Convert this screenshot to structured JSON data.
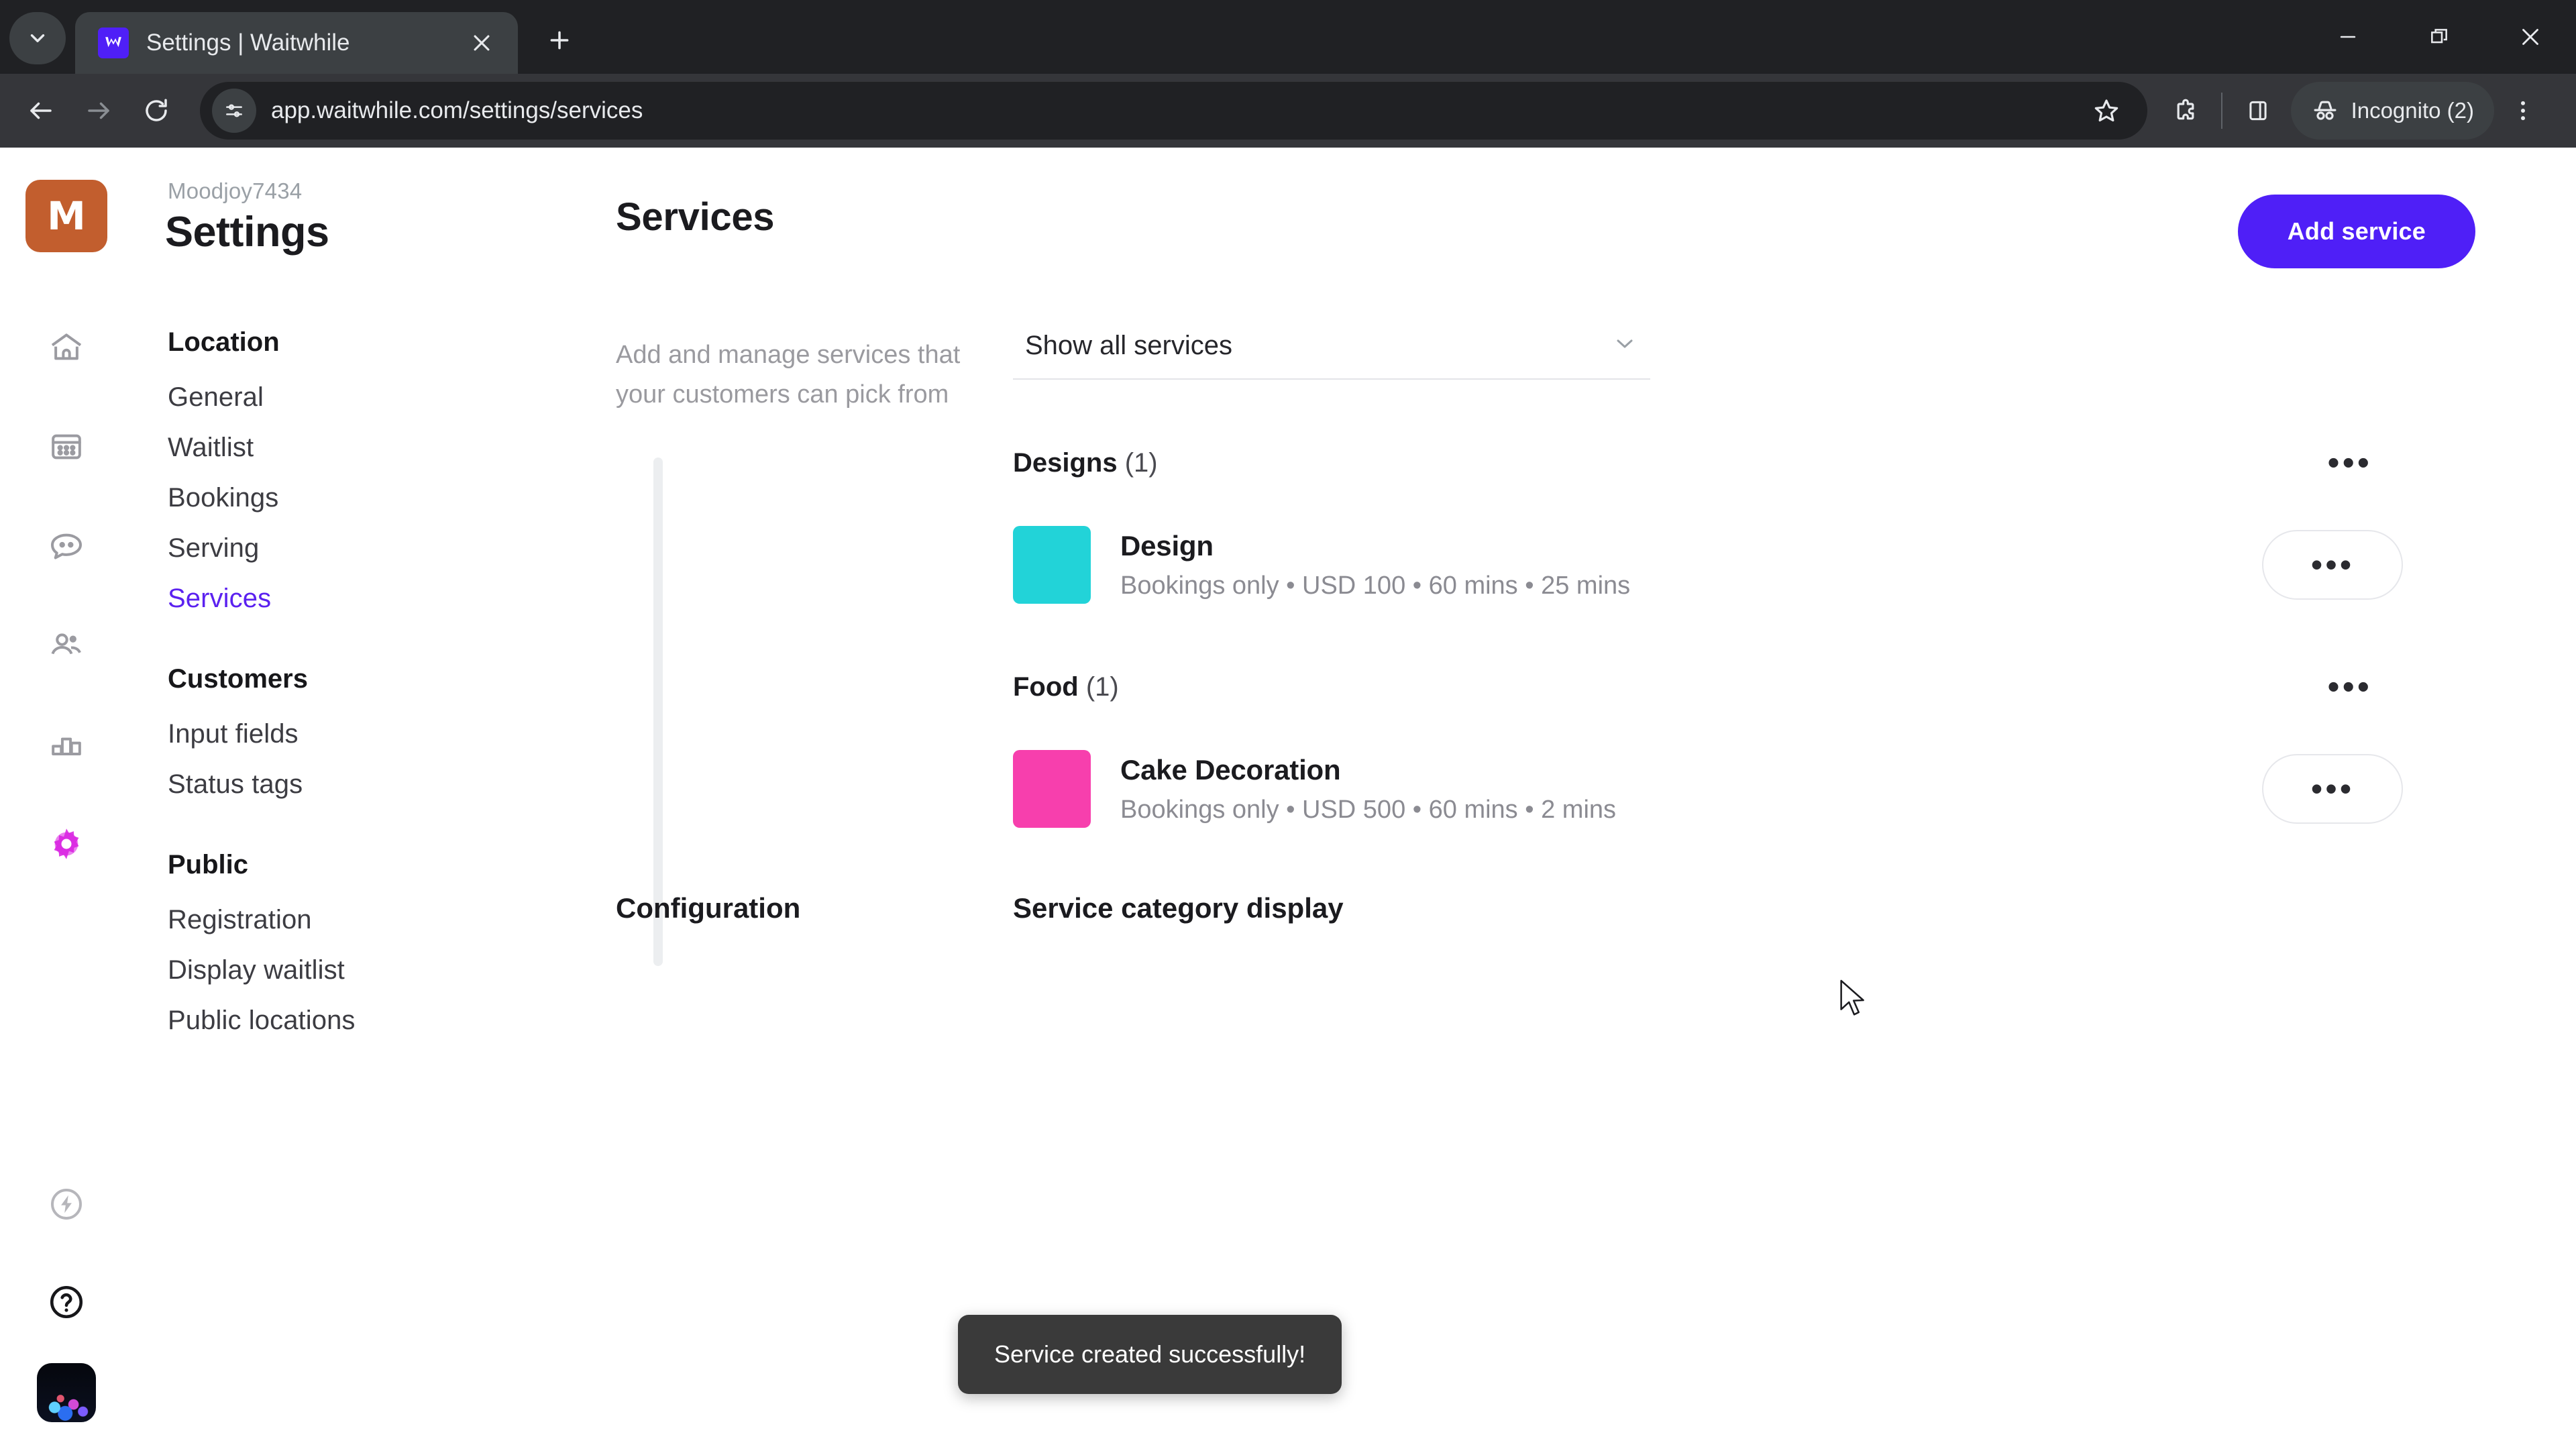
{
  "browser": {
    "tab": {
      "title": "Settings | Waitwhile",
      "favicon_letter": "W",
      "favicon_color": "#4f1ff7"
    },
    "omnibox": {
      "url": "app.waitwhile.com/settings/services"
    },
    "profile": {
      "label": "Incognito (2)"
    },
    "icons": {
      "tab_search": "tab-search-icon",
      "tab_close": "close-icon",
      "new_tab": "new-tab-icon",
      "minimize": "minimize-icon",
      "maximize": "maximize-restore-icon",
      "window_close": "window-close-icon",
      "back": "back-arrow-icon",
      "forward": "forward-arrow-icon",
      "reload": "reload-icon",
      "site_settings": "site-settings-icon",
      "bookmark": "bookmark-star-icon",
      "extensions": "extensions-puzzle-icon",
      "side_panel": "side-panel-icon",
      "incognito": "incognito-hat-icon",
      "menu": "three-dot-menu-icon"
    }
  },
  "rail": {
    "logo_letter": "M",
    "logo_color": "#c25e2e",
    "items": [
      {
        "name": "home-icon"
      },
      {
        "name": "calendar-icon"
      },
      {
        "name": "messages-icon"
      },
      {
        "name": "customers-icon"
      },
      {
        "name": "analytics-icon"
      },
      {
        "name": "settings-gear-icon"
      }
    ],
    "bottom": [
      {
        "name": "power-lightning-icon"
      },
      {
        "name": "help-question-icon"
      },
      {
        "name": "user-avatar"
      }
    ]
  },
  "settings_nav": {
    "org_name": "Moodjoy7434",
    "page_title": "Settings",
    "groups": [
      {
        "title": "Location",
        "items": [
          {
            "label": "General",
            "active": false
          },
          {
            "label": "Waitlist",
            "active": false
          },
          {
            "label": "Bookings",
            "active": false
          },
          {
            "label": "Serving",
            "active": false
          },
          {
            "label": "Services",
            "active": true
          }
        ]
      },
      {
        "title": "Customers",
        "items": [
          {
            "label": "Input fields",
            "active": false
          },
          {
            "label": "Status tags",
            "active": false
          }
        ]
      },
      {
        "title": "Public",
        "items": [
          {
            "label": "Registration",
            "active": false
          },
          {
            "label": "Display waitlist",
            "active": false
          },
          {
            "label": "Public locations",
            "active": false
          }
        ]
      }
    ]
  },
  "main": {
    "title": "Services",
    "add_button": "Add service",
    "accent_color": "#4f1ff7",
    "description": "Add and manage services that your customers can pick from",
    "filter": {
      "value": "Show all services",
      "chevron": "chevron-down-icon"
    },
    "categories": [
      {
        "name": "Designs",
        "count": "(1)",
        "services": [
          {
            "name": "Design",
            "meta": "Bookings only • USD 100 • 60 mins • 25 mins",
            "color": "#22d3d8"
          }
        ]
      },
      {
        "name": "Food",
        "count": "(1)",
        "services": [
          {
            "name": "Cake Decoration",
            "meta": "Bookings only • USD 500 • 60 mins • 2 mins",
            "color": "#f73fad"
          }
        ]
      }
    ],
    "configuration": {
      "label": "Configuration",
      "value": "Service category display"
    },
    "menu_glyph": "•••"
  },
  "toast": {
    "message": "Service created successfully!"
  }
}
